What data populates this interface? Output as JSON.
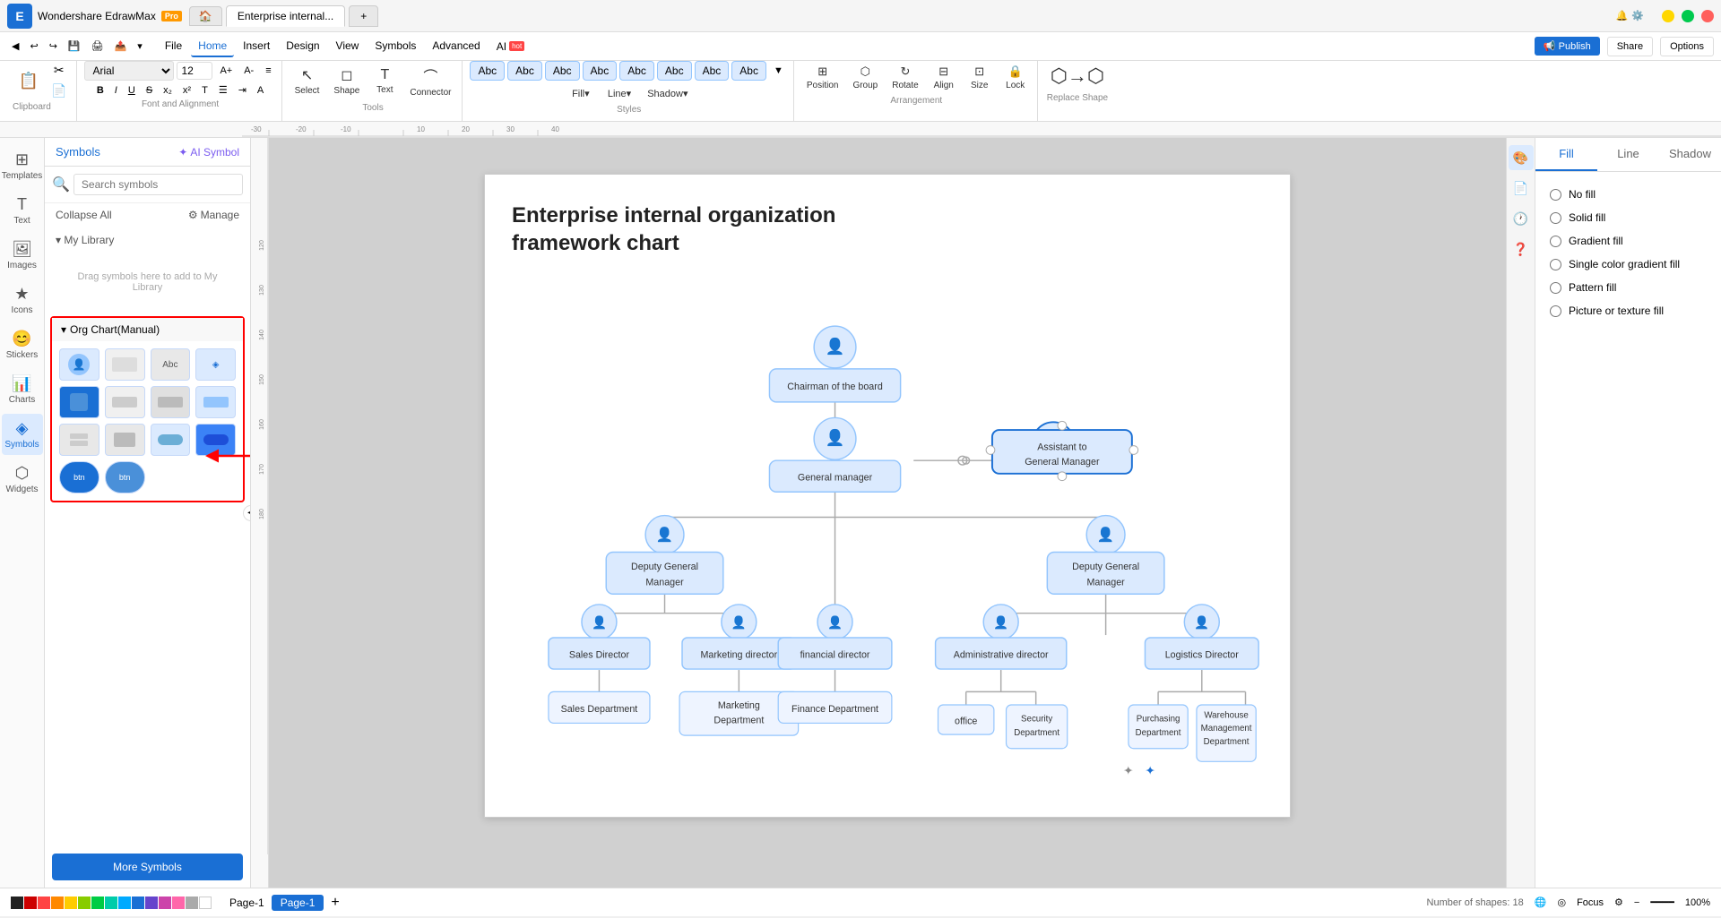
{
  "app": {
    "name": "Wondershare EdrawMax",
    "edition": "Pro",
    "tab_active": "Enterprise internal...",
    "tab_plus": "+",
    "window_controls": [
      "minimize",
      "restore",
      "close"
    ]
  },
  "menu": {
    "items": [
      "File",
      "Home",
      "Insert",
      "Design",
      "View",
      "Symbols",
      "Advanced",
      "AI"
    ],
    "active": "Home",
    "ai_badge": "hot"
  },
  "toolbar": {
    "clipboard_label": "Clipboard",
    "font_label": "Font and Alignment",
    "tools_label": "Tools",
    "styles_label": "Styles",
    "arrangement_label": "Arrangement",
    "replace_label": "Replace",
    "font_family": "Arial",
    "font_size": "12",
    "select_label": "Select",
    "shape_label": "Shape",
    "text_label": "Text",
    "connector_label": "Connector",
    "fill_label": "Fill",
    "line_label": "Line",
    "shadow_label": "Shadow",
    "position_label": "Position",
    "group_label": "Group",
    "rotate_label": "Rotate",
    "align_label": "Align",
    "size_label": "Size",
    "lock_label": "Lock",
    "replace_shape_label": "Replace Shape",
    "style_abcs": [
      "Abc",
      "Abc",
      "Abc",
      "Abc",
      "Abc",
      "Abc",
      "Abc",
      "Abc"
    ]
  },
  "left_panel": {
    "symbols_label": "Symbols",
    "ai_symbol_label": "AI Symbol",
    "search_placeholder": "Search symbols",
    "collapse_all_label": "Collapse All",
    "manage_label": "Manage",
    "my_library_label": "My Library",
    "drag_drop_text": "Drag symbols here to add to My Library",
    "org_chart_label": "Org Chart(Manual)",
    "more_symbols_label": "More Symbols"
  },
  "sidebar": {
    "items": [
      {
        "label": "Templates",
        "icon": "⊞"
      },
      {
        "label": "Text",
        "icon": "T"
      },
      {
        "label": "Images",
        "icon": "🖼"
      },
      {
        "label": "Icons",
        "icon": "★"
      },
      {
        "label": "Stickers",
        "icon": "😊"
      },
      {
        "label": "Charts",
        "icon": "📊"
      },
      {
        "label": "Symbols",
        "icon": "◈"
      },
      {
        "label": "Widgets",
        "icon": "⬡"
      }
    ],
    "active": "Symbols"
  },
  "canvas": {
    "title_line1": "Enterprise internal organization",
    "title_line2": "framework chart",
    "nodes": {
      "chairman": "Chairman of the board",
      "general_manager": "General manager",
      "assistant": "Assistant to General Manager",
      "deputy_left": "Deputy General Manager",
      "deputy_right": "Deputy General Manager",
      "sales_director": "Sales Director",
      "marketing_director": "Marketing director",
      "financial_director": "financial director",
      "admin_director": "Administrative director",
      "logistics_director": "Logistics Director",
      "sales_dept": "Sales Department",
      "marketing_dept": "Marketing Department",
      "finance_dept": "Finance Department",
      "office": "office",
      "security_dept": "Security Department",
      "purchasing_dept": "Purchasing Department",
      "warehouse_dept": "Warehouse Management Department"
    }
  },
  "right_panel": {
    "tabs": [
      "Fill",
      "Line",
      "Shadow"
    ],
    "active_tab": "Fill",
    "fill_options": [
      {
        "label": "No fill",
        "checked": false
      },
      {
        "label": "Solid fill",
        "checked": false
      },
      {
        "label": "Gradient fill",
        "checked": false
      },
      {
        "label": "Single color gradient fill",
        "checked": false
      },
      {
        "label": "Pattern fill",
        "checked": false
      },
      {
        "label": "Picture or texture fill",
        "checked": false
      }
    ],
    "icons": [
      "fill",
      "page",
      "history",
      "question"
    ]
  },
  "bottom": {
    "page_label": "Page-1",
    "add_page_label": "+",
    "page_tab_label": "Page-1",
    "shapes_count": "Number of shapes: 18",
    "focus_label": "Focus",
    "zoom_label": "100%"
  }
}
